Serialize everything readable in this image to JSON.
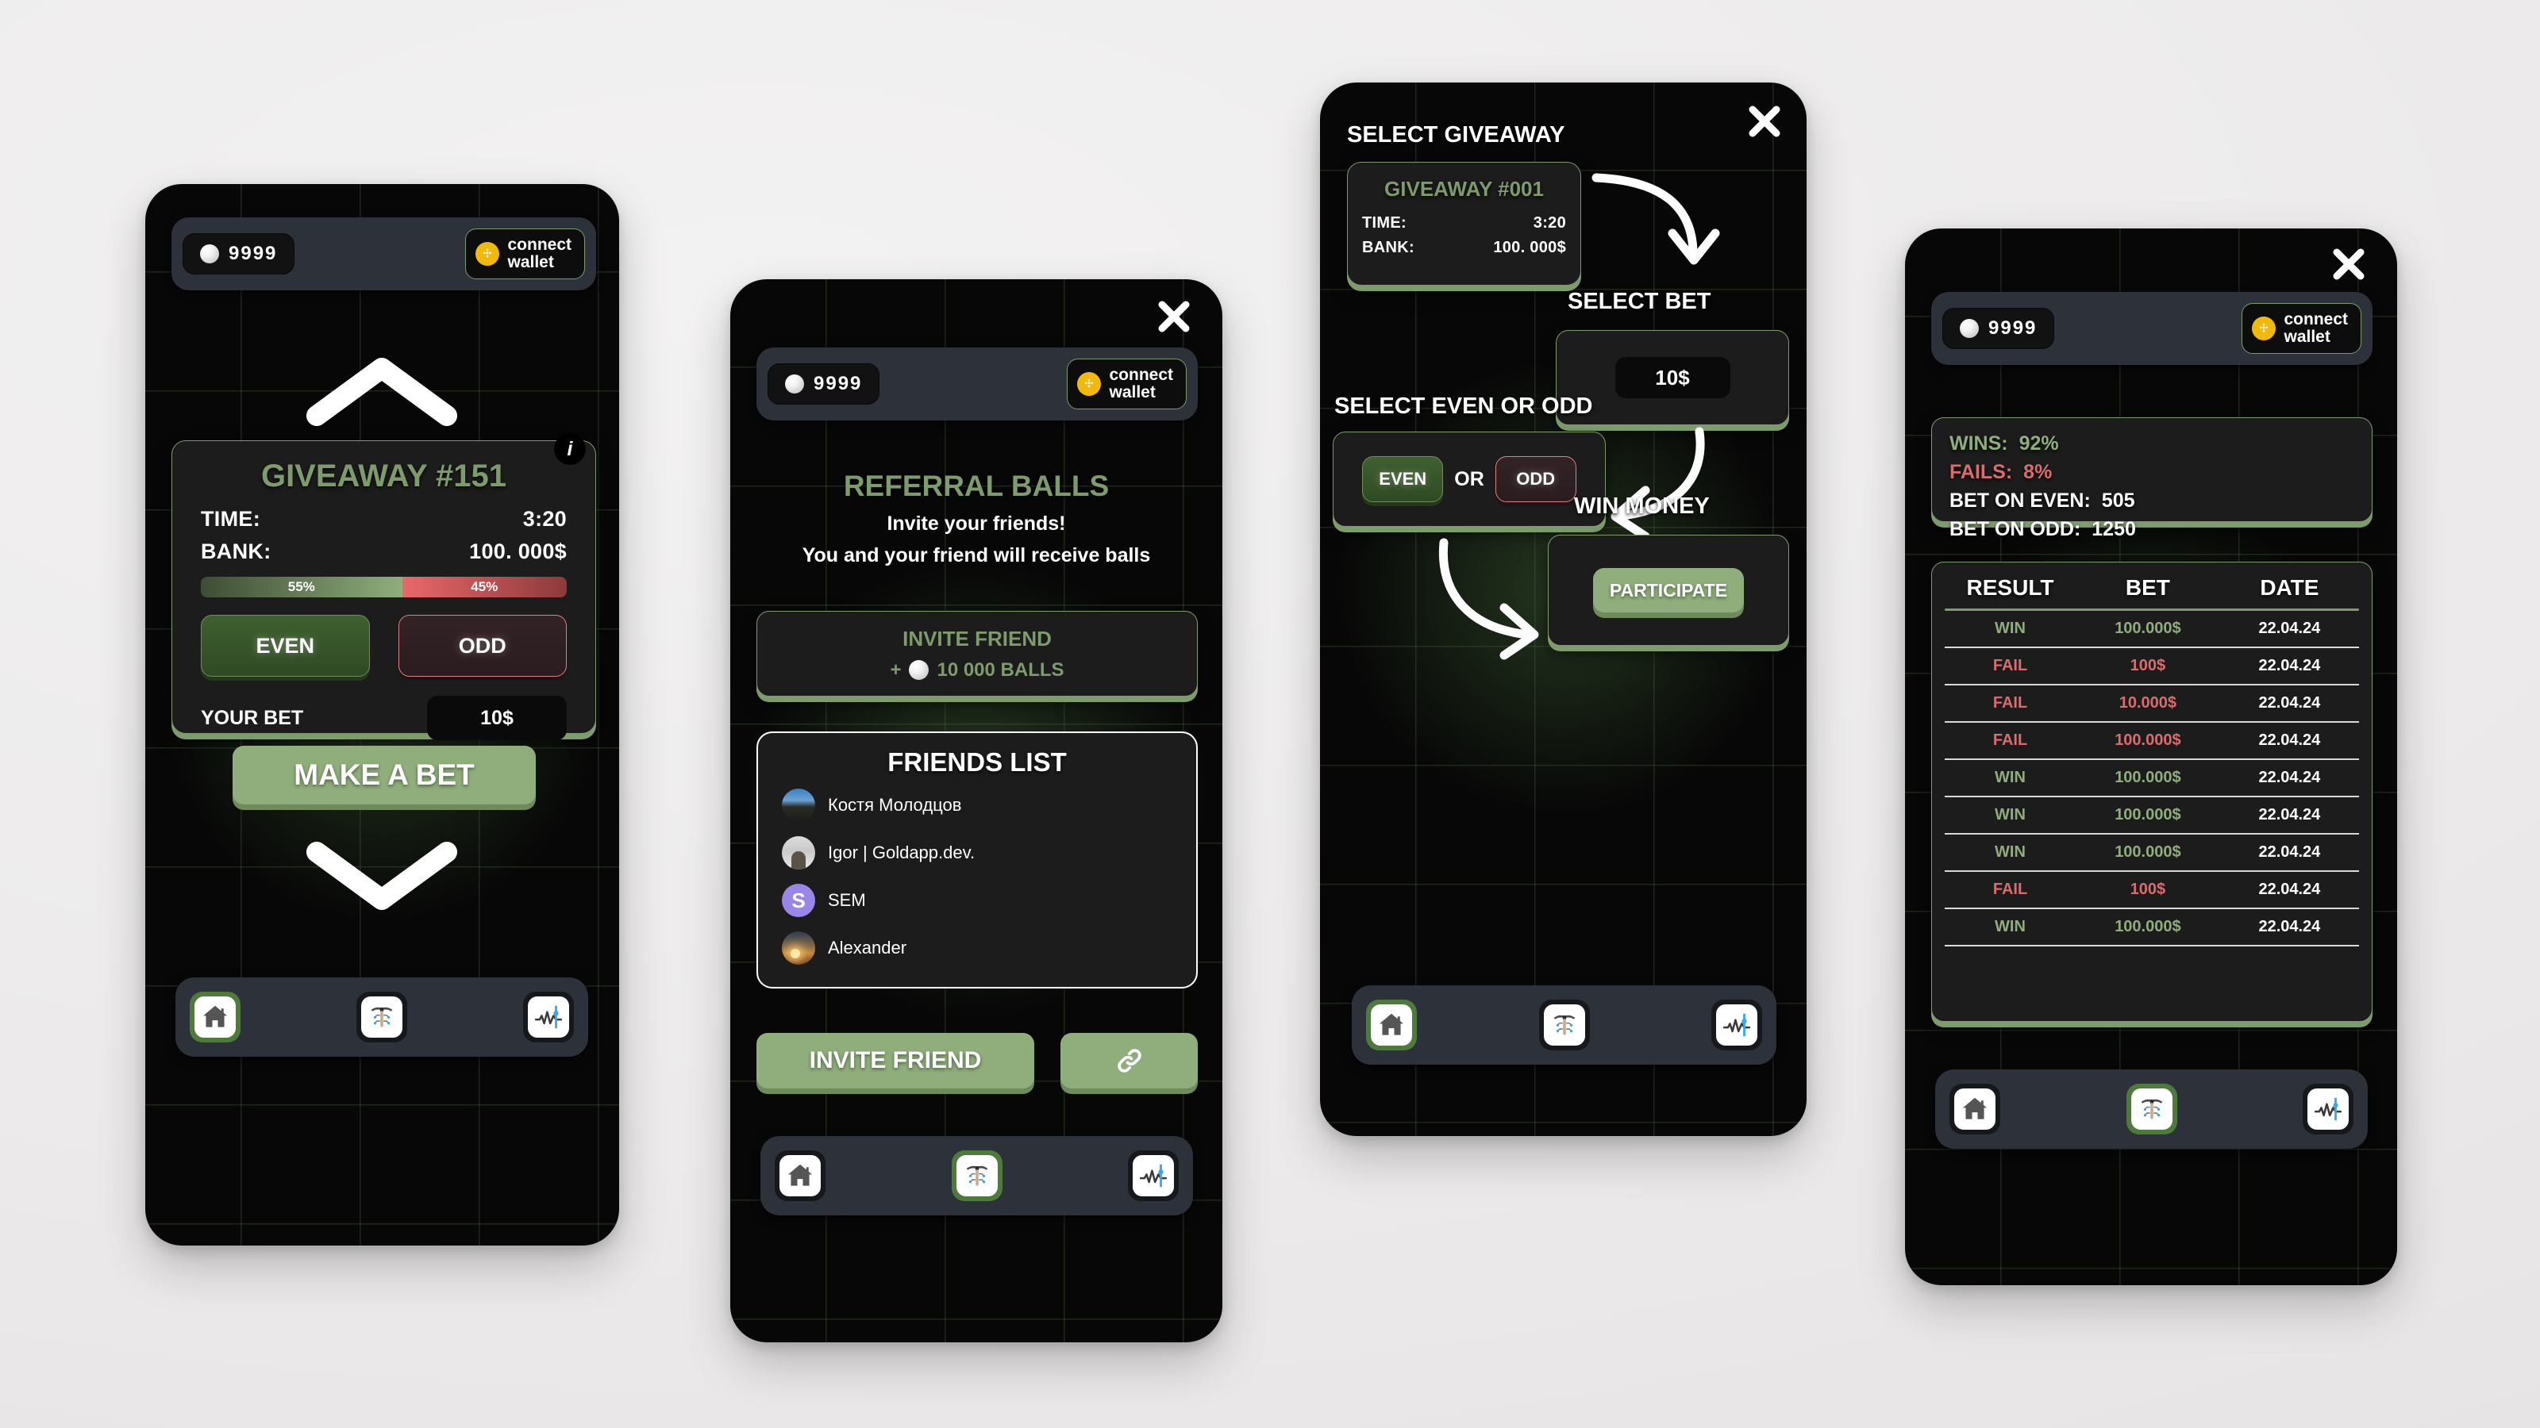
{
  "common": {
    "balance": "9999",
    "wallet_line1": "connect",
    "wallet_line2": "wallet",
    "nav": [
      {
        "name": "home",
        "icon": "home-icon"
      },
      {
        "name": "mining",
        "icon": "pickaxe-circuit-icon"
      },
      {
        "name": "stats",
        "icon": "chart-pulse-icon"
      }
    ]
  },
  "screen1": {
    "giveaway_title": "GIVEAWAY #151",
    "info_badge": "i",
    "time_label": "TIME:",
    "time_value": "3:20",
    "bank_label": "BANK:",
    "bank_value": "100. 000$",
    "even_percent": "55%",
    "odd_percent": "45%",
    "even_label": "EVEN",
    "odd_label": "ODD",
    "your_bet_label": "YOUR BET",
    "bet_value": "10$",
    "make_bet_label": "MAKE A BET",
    "active_nav": 0
  },
  "screen2": {
    "title": "REFERRAL BALLS",
    "subtitle1": "Invite your friends!",
    "subtitle2": "You and your friend will receive balls",
    "invite_card_title": "INVITE FRIEND",
    "invite_card_reward_prefix": "+",
    "invite_card_reward": "10 000 BALLS",
    "friends_title": "FRIENDS LIST",
    "friends": [
      {
        "name": "Костя Молодцов",
        "avatar": "mountain-photo-avatar"
      },
      {
        "name": "Igor | Goldapp.dev.",
        "avatar": "portrait-photo-avatar"
      },
      {
        "name": "SEM",
        "avatar": "letter-avatar-s",
        "initial": "S"
      },
      {
        "name": "Alexander",
        "avatar": "sunset-photo-avatar"
      }
    ],
    "invite_button": "INVITE FRIEND",
    "copy_link_icon": "link-icon",
    "active_nav": 1
  },
  "screen3": {
    "header": "SELECT GIVEAWAY",
    "giveaway_title": "GIVEAWAY #001",
    "time_label": "TIME:",
    "time_value": "3:20",
    "bank_label": "BANK:",
    "bank_value": "100. 000$",
    "select_bet_label": "SELECT BET",
    "bet_value": "10$",
    "select_even_odd_label": "SELECT EVEN OR ODD",
    "even_label": "EVEN",
    "or_label": "OR",
    "odd_label": "ODD",
    "win_money_label": "WIN MONEY",
    "participate_label": "PARTICIPATE",
    "active_nav": 0
  },
  "screen4": {
    "stats": [
      {
        "label": "WINS:",
        "value": "92%",
        "tone": "green"
      },
      {
        "label": "FAILS:",
        "value": "8%",
        "tone": "red"
      },
      {
        "label": "BET ON EVEN:",
        "value": "505",
        "tone": "white"
      },
      {
        "label": "BET ON ODD:",
        "value": "1250",
        "tone": "white"
      }
    ],
    "history_headers": [
      "RESULT",
      "BET",
      "DATE"
    ],
    "history": [
      {
        "result": "WIN",
        "bet": "100.000$",
        "date": "22.04.24",
        "tone": "green"
      },
      {
        "result": "FAIL",
        "bet": "100$",
        "date": "22.04.24",
        "tone": "red"
      },
      {
        "result": "FAIL",
        "bet": "10.000$",
        "date": "22.04.24",
        "tone": "red"
      },
      {
        "result": "FAIL",
        "bet": "100.000$",
        "date": "22.04.24",
        "tone": "red"
      },
      {
        "result": "WIN",
        "bet": "100.000$",
        "date": "22.04.24",
        "tone": "green"
      },
      {
        "result": "WIN",
        "bet": "100.000$",
        "date": "22.04.24",
        "tone": "green"
      },
      {
        "result": "WIN",
        "bet": "100.000$",
        "date": "22.04.24",
        "tone": "green"
      },
      {
        "result": "FAIL",
        "bet": "100$",
        "date": "22.04.24",
        "tone": "red"
      },
      {
        "result": "WIN",
        "bet": "100.000$",
        "date": "22.04.24",
        "tone": "green"
      }
    ],
    "active_nav": 1
  },
  "colors": {
    "accent_green": "#7e9b6c",
    "bright_green": "#8fae7b",
    "fail_red": "#d96c6c",
    "binance_yellow": "#f0b90b",
    "page_bg": "#efeeee",
    "phone_bg": "#070707"
  }
}
